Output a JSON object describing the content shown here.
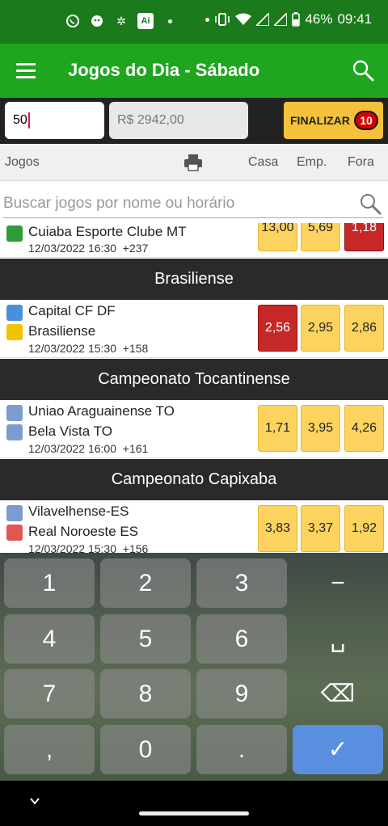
{
  "status_bar": {
    "battery": "46%",
    "time": "09:41"
  },
  "app_bar": {
    "title": "Jogos do Dia - Sábado"
  },
  "bet_bar": {
    "stake_value": "50",
    "balance": "R$ 2942,00",
    "finalize_label": "FINALIZAR",
    "selection_count": "10"
  },
  "columns": {
    "games": "Jogos",
    "home": "Casa",
    "draw": "Emp.",
    "away": "Fora"
  },
  "search": {
    "placeholder": "Buscar jogos por nome ou horário"
  },
  "matches": [
    {
      "home": "Cuiaba Esporte Clube MT",
      "away": "",
      "date": "12/03/2022 16:30",
      "extra": "+237",
      "odds": [
        "13,00",
        "5,69",
        "1,18"
      ],
      "selected": 2
    },
    {
      "league": "Brasiliense",
      "home": "Capital CF DF",
      "away": "Brasiliense",
      "date": "12/03/2022 15:30",
      "extra": "+158",
      "odds": [
        "2,56",
        "2,95",
        "2,86"
      ],
      "selected": 0
    },
    {
      "league": "Campeonato Tocantinense",
      "home": "Uniao Araguainense TO",
      "away": "Bela Vista TO",
      "date": "12/03/2022 16:00",
      "extra": "+161",
      "odds": [
        "1,71",
        "3,95",
        "4,26"
      ],
      "selected": -1
    },
    {
      "league": "Campeonato Capixaba",
      "home": "Vilavelhense-ES",
      "away": "Real Noroeste ES",
      "date": "12/03/2022 15:30",
      "extra": "+156",
      "odds": [
        "3,83",
        "3,37",
        "1,92"
      ],
      "selected": -1
    }
  ],
  "keyboard": {
    "keys": [
      "1",
      "2",
      "3",
      "−",
      "4",
      "5",
      "6",
      "␣",
      "7",
      "8",
      "9",
      "⌫",
      ",",
      "0",
      ".",
      "✓"
    ]
  },
  "colors": {
    "status_bar": "#1b7a1b",
    "app_bar": "#1fa51f",
    "odd": "#fdd360",
    "odd_selected": "#c62828",
    "finalize": "#f4c23a"
  }
}
